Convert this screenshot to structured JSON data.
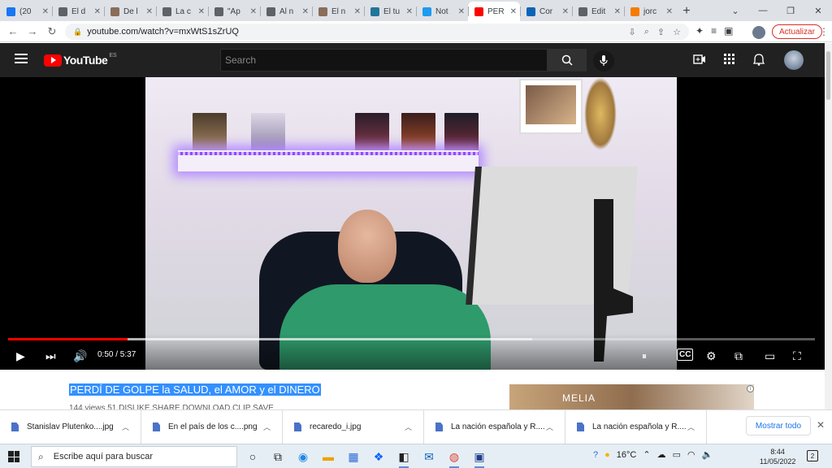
{
  "browser": {
    "tabs": [
      {
        "label": "(20",
        "favicon": "facebook-icon",
        "color": "#1877f2"
      },
      {
        "label": "El d",
        "favicon": "mail-icon",
        "color": "#5f6368"
      },
      {
        "label": "De l",
        "favicon": "photo-icon",
        "color": "#8a6d5a"
      },
      {
        "label": "La c",
        "favicon": "mail-icon",
        "color": "#5f6368"
      },
      {
        "label": "\"Ap",
        "favicon": "mail-icon",
        "color": "#5f6368"
      },
      {
        "label": "Al n",
        "favicon": "mail-icon",
        "color": "#5f6368"
      },
      {
        "label": "El n",
        "favicon": "photo-icon",
        "color": "#8a6d5a"
      },
      {
        "label": "El tu",
        "favicon": "wordpress-icon",
        "color": "#21759b"
      },
      {
        "label": "Not",
        "favicon": "twitter-icon",
        "color": "#1d9bf0"
      },
      {
        "label": "PER",
        "favicon": "youtube-icon",
        "color": "#ff0000",
        "active": true
      },
      {
        "label": "Cor",
        "favicon": "outlook-icon",
        "color": "#0a64b8"
      },
      {
        "label": "Edit",
        "favicon": "mail-icon",
        "color": "#5f6368"
      },
      {
        "label": "jorc",
        "favicon": "blog-icon",
        "color": "#f57c00"
      }
    ],
    "url": "youtube.com/watch?v=mxWtS1sZrUQ",
    "update_label": "Actualizar"
  },
  "youtube": {
    "logo_text": "YouTube",
    "country_code": "ES",
    "search_placeholder": "Search"
  },
  "player": {
    "time_display": "0:50 / 5:37",
    "played_fraction": 0.148,
    "buffered_fraction": 0.65
  },
  "video": {
    "title": "PERDÍ DE GOLPE la SALUD, el AMOR y el DINERO",
    "meta_partial": "144 views     51     DISLIKE     SHARE     DOWNLOAD     CLIP     SAVE"
  },
  "ad": {
    "brand": "MELIA"
  },
  "downloads": {
    "items": [
      {
        "name": "Stanislav Plutenko....jpg"
      },
      {
        "name": "En el país de los c....png"
      },
      {
        "name": "recaredo_i.jpg"
      },
      {
        "name": "La nación española y R...."
      },
      {
        "name": "La nación española y R...."
      }
    ],
    "show_all": "Mostrar todo"
  },
  "taskbar": {
    "search_placeholder": "Escribe aquí para buscar",
    "temperature": "16°C",
    "time": "8:44",
    "date": "11/05/2022",
    "notifications": "2"
  }
}
